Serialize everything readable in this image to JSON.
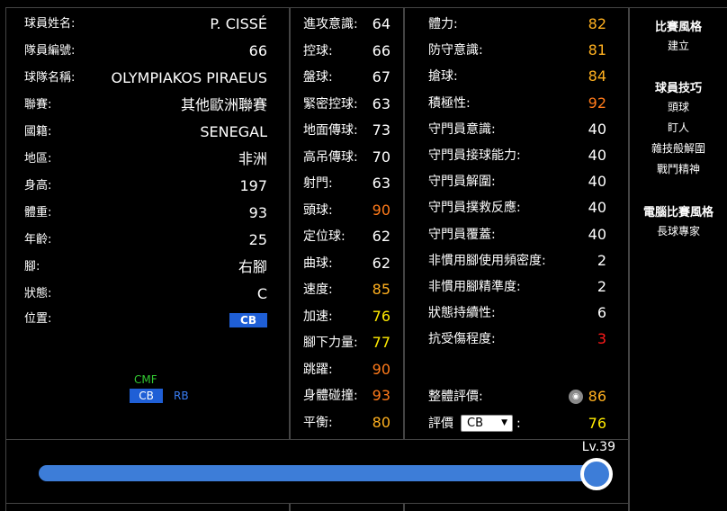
{
  "basic": {
    "rows": [
      {
        "label": "球員姓名:",
        "value": "P. CISSÉ"
      },
      {
        "label": "隊員編號:",
        "value": "66"
      },
      {
        "label": "球隊名稱:",
        "value": "OLYMPIAKOS PIRAEUS"
      },
      {
        "label": "聯賽:",
        "value": "其他歐洲聯賽"
      },
      {
        "label": "國籍:",
        "value": "SENEGAL"
      },
      {
        "label": "地區:",
        "value": "非洲"
      },
      {
        "label": "身高:",
        "value": "197"
      },
      {
        "label": "體重:",
        "value": "93"
      },
      {
        "label": "年齡:",
        "value": "25"
      },
      {
        "label": "腳:",
        "value": "右腳"
      },
      {
        "label": "狀態:",
        "value": "C"
      }
    ],
    "position_label": "位置:",
    "position_value": "CB",
    "field_positions": {
      "cmf": "CMF",
      "cb": "CB",
      "rb": "RB"
    }
  },
  "stats_a": [
    {
      "label": "進攻意識:",
      "value": "64",
      "color": "#ffffff"
    },
    {
      "label": "控球:",
      "value": "66",
      "color": "#ffffff"
    },
    {
      "label": "盤球:",
      "value": "67",
      "color": "#ffffff"
    },
    {
      "label": "緊密控球:",
      "value": "63",
      "color": "#ffffff"
    },
    {
      "label": "地面傳球:",
      "value": "73",
      "color": "#ffffff"
    },
    {
      "label": "高吊傳球:",
      "value": "70",
      "color": "#ffffff"
    },
    {
      "label": "射門:",
      "value": "63",
      "color": "#ffffff"
    },
    {
      "label": "頭球:",
      "value": "90",
      "color": "#ff7a1a"
    },
    {
      "label": "定位球:",
      "value": "62",
      "color": "#ffffff"
    },
    {
      "label": "曲球:",
      "value": "62",
      "color": "#ffffff"
    },
    {
      "label": "速度:",
      "value": "85",
      "color": "#ffb01f"
    },
    {
      "label": "加速:",
      "value": "76",
      "color": "#ffea00"
    },
    {
      "label": "腳下力量:",
      "value": "77",
      "color": "#ffea00"
    },
    {
      "label": "跳躍:",
      "value": "90",
      "color": "#ff7a1a"
    },
    {
      "label": "身體碰撞:",
      "value": "93",
      "color": "#ff7a1a"
    },
    {
      "label": "平衡:",
      "value": "80",
      "color": "#ffb01f"
    }
  ],
  "stats_b": [
    {
      "label": "體力:",
      "value": "82",
      "color": "#ffb01f"
    },
    {
      "label": "防守意識:",
      "value": "81",
      "color": "#ffb01f"
    },
    {
      "label": "搶球:",
      "value": "84",
      "color": "#ffb01f"
    },
    {
      "label": "積極性:",
      "value": "92",
      "color": "#ff7a1a"
    },
    {
      "label": "守門員意識:",
      "value": "40",
      "color": "#ffffff"
    },
    {
      "label": "守門員接球能力:",
      "value": "40",
      "color": "#ffffff"
    },
    {
      "label": "守門員解圍:",
      "value": "40",
      "color": "#ffffff"
    },
    {
      "label": "守門員撲救反應:",
      "value": "40",
      "color": "#ffffff"
    },
    {
      "label": "守門員覆蓋:",
      "value": "40",
      "color": "#ffffff"
    },
    {
      "label": "非慣用腳使用頻密度:",
      "value": "2",
      "color": "#ffffff"
    },
    {
      "label": "非慣用腳精準度:",
      "value": "2",
      "color": "#ffffff"
    },
    {
      "label": "狀態持續性:",
      "value": "6",
      "color": "#ffffff"
    },
    {
      "label": "抗受傷程度:",
      "value": "3",
      "color": "#ff1a1a"
    }
  ],
  "overall": {
    "label": "整體評價:",
    "value": "86",
    "color": "#ffb01f"
  },
  "rating": {
    "label": "評價",
    "select_value": "CB",
    "colon": ":",
    "value": "76",
    "color": "#ffea00"
  },
  "sidebar": {
    "play_style_title": "比賽風格",
    "play_style": [
      "建立"
    ],
    "skills_title": "球員技巧",
    "skills": [
      "頭球",
      "盯人",
      "雜技般解圍",
      "戰鬥精神"
    ],
    "com_style_title": "電腦比賽風格",
    "com_style": [
      "長球專家"
    ]
  },
  "level": {
    "text": "Lv.39",
    "fraction": 1.0
  }
}
